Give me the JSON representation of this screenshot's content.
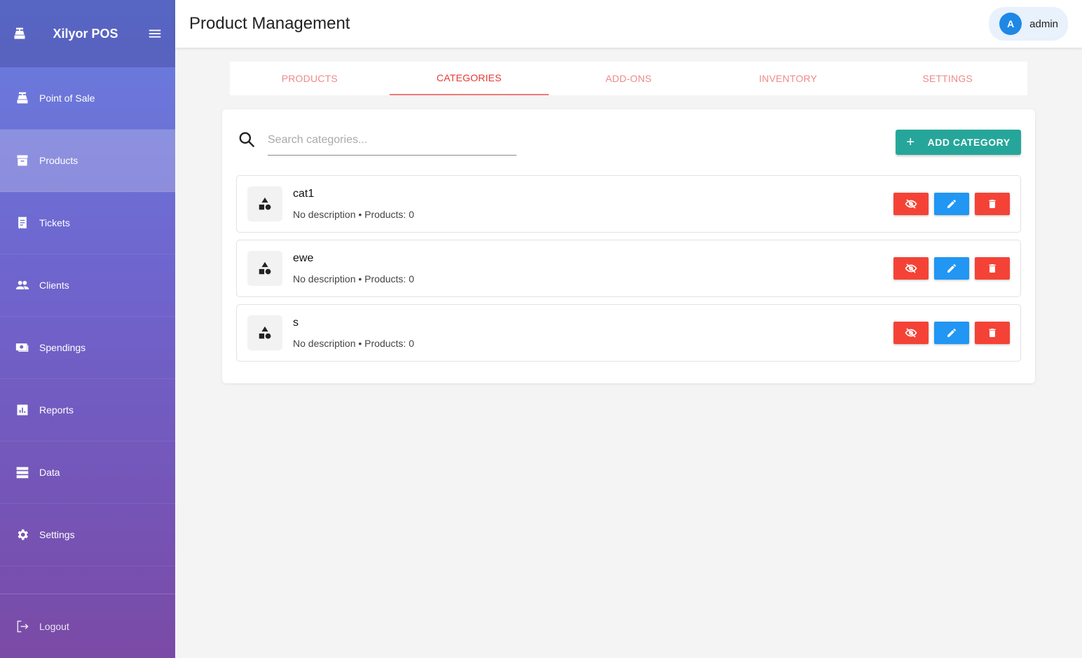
{
  "app": {
    "name": "Xilyor POS"
  },
  "sidebar": {
    "items": [
      {
        "label": "Point of Sale",
        "icon": "cash-register-icon"
      },
      {
        "label": "Products",
        "icon": "archive-box-icon",
        "active": true
      },
      {
        "label": "Tickets",
        "icon": "receipt-icon"
      },
      {
        "label": "Clients",
        "icon": "people-icon"
      },
      {
        "label": "Spendings",
        "icon": "money-icon"
      },
      {
        "label": "Reports",
        "icon": "bar-chart-icon"
      },
      {
        "label": "Data",
        "icon": "storage-icon"
      },
      {
        "label": "Settings",
        "icon": "gear-icon"
      }
    ],
    "logout_label": "Logout"
  },
  "header": {
    "title": "Product Management",
    "user": {
      "initial": "A",
      "name": "admin"
    }
  },
  "tabs": [
    {
      "label": "PRODUCTS"
    },
    {
      "label": "CATEGORIES",
      "active": true
    },
    {
      "label": "ADD-ONS"
    },
    {
      "label": "INVENTORY"
    },
    {
      "label": "SETTINGS"
    }
  ],
  "search": {
    "placeholder": "Search categories...",
    "value": ""
  },
  "add_button": {
    "label": "ADD CATEGORY"
  },
  "categories": [
    {
      "name": "cat1",
      "meta": "No description • Products: 0"
    },
    {
      "name": "ewe",
      "meta": "No description • Products: 0"
    },
    {
      "name": "s",
      "meta": "No description • Products: 0"
    }
  ],
  "colors": {
    "accent_tab": "#e53935",
    "add_button": "#26a69a",
    "toggle_button": "#f44336",
    "edit_button": "#2196f3",
    "delete_button": "#f44336",
    "avatar": "#1e88e5"
  }
}
